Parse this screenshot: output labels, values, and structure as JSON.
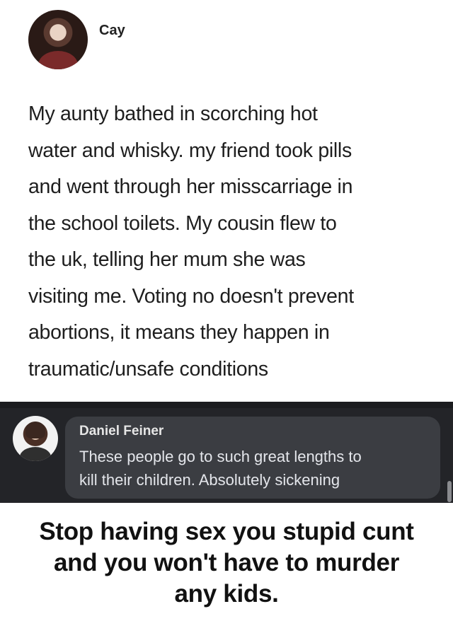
{
  "tweet": {
    "author": "Cay",
    "text_lines": [
      "My aunty bathed in scorching hot",
      "water and whisky. my friend took pills",
      "and went through her misscarriage in",
      "the school toilets. My cousin flew to",
      "the uk, telling her mum she was",
      "visiting me. Voting no doesn't prevent",
      "abortions, it means they happen in",
      "traumatic/unsafe conditions"
    ]
  },
  "comment": {
    "author": "Daniel Feiner",
    "text_lines": [
      "These people go to such great lengths to",
      "kill their children. Absolutely sickening"
    ]
  },
  "caption": {
    "lines": [
      "Stop having sex you stupid cunt",
      "and you won't have to murder",
      "any kids."
    ]
  }
}
